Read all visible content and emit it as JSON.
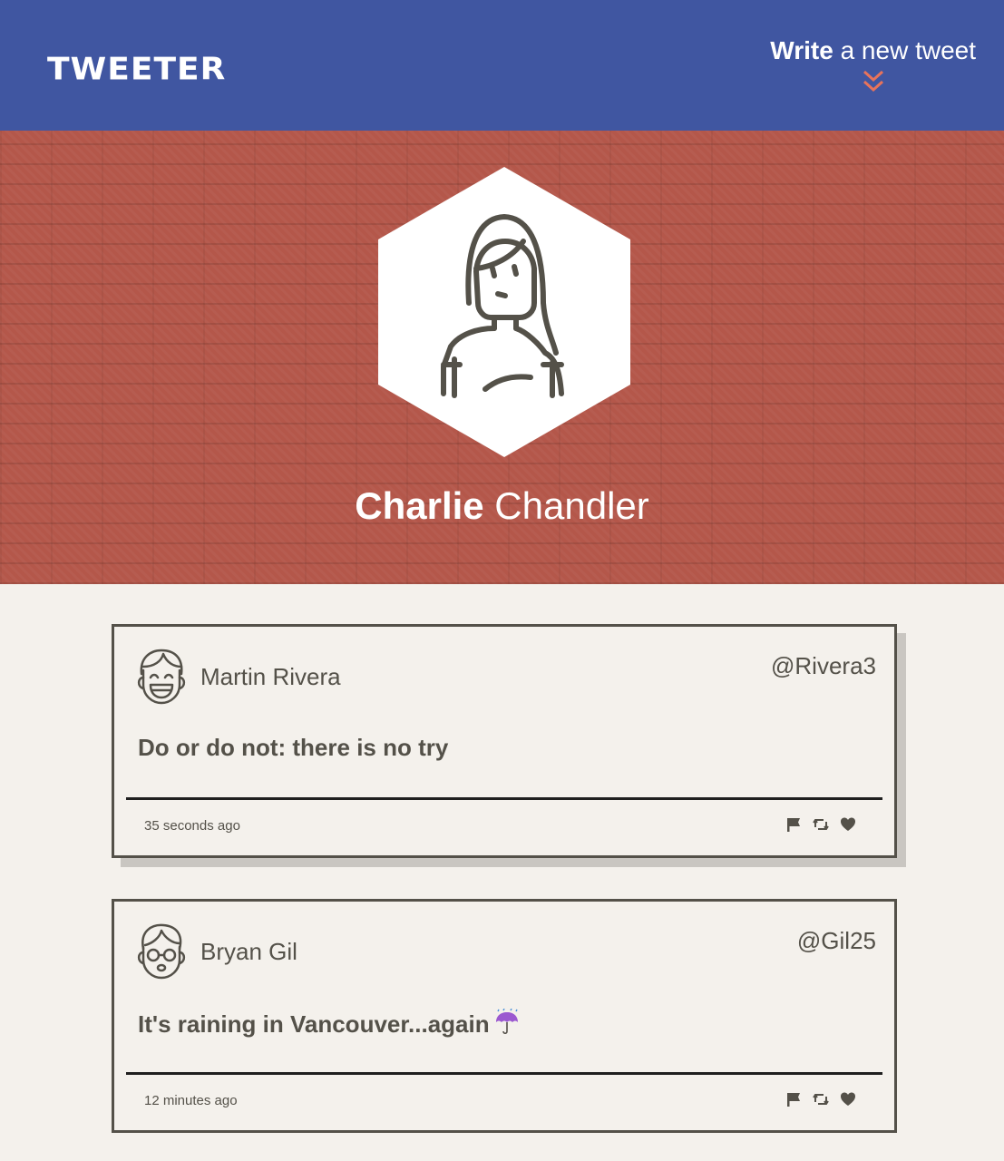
{
  "nav": {
    "brand": "TWEETER",
    "compose_bold": "Write",
    "compose_rest": " a new tweet",
    "compose_icon": "double-chevron-down-icon",
    "accent_color": "#e8735b"
  },
  "profile": {
    "first_name": "Charlie",
    "last_name": " Chandler",
    "avatar_icon": "woman-avatar-icon",
    "background_color": "#b4574a"
  },
  "tweets": [
    {
      "name": "Martin Rivera",
      "handle": "@Rivera3",
      "content": "Do or do not: there is no try",
      "time": "35 seconds ago",
      "avatar_icon": "laughing-man-avatar-icon"
    },
    {
      "name": "Bryan Gil",
      "handle": "@Gil25",
      "content": "It's raining in Vancouver...again",
      "emoji_icon": "umbrella-rain-icon",
      "time": "12 minutes ago",
      "avatar_icon": "glasses-man-avatar-icon"
    }
  ],
  "actions": [
    "flag-icon",
    "retweet-icon",
    "heart-icon"
  ],
  "colors": {
    "nav": "#4056a1",
    "page": "#f4f1ec",
    "text": "#545149"
  }
}
